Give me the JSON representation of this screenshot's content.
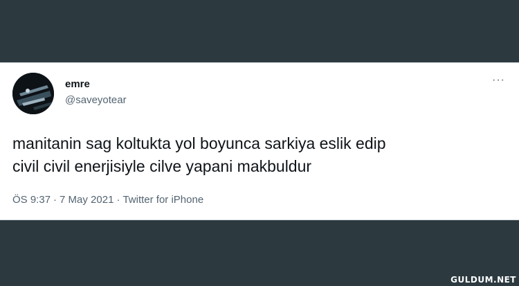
{
  "tweet": {
    "display_name": "emre",
    "handle": "@saveyotear",
    "more_icon": "more-horizontal-icon",
    "more_glyph": "···",
    "text_lines": [
      "manitanin sag koltukta yol boyunca sarkiya eslik edip",
      "civil civil enerjisiyle cilve yapani makbuldur"
    ],
    "time": "ÖS 9:37",
    "separator": "·",
    "date": "7 May 2021",
    "source": "Twitter for iPhone"
  },
  "watermark": "GULDUM.NET",
  "colors": {
    "background": "#2c3a40",
    "card": "#ffffff",
    "text": "#0f1419",
    "muted": "#536471"
  }
}
